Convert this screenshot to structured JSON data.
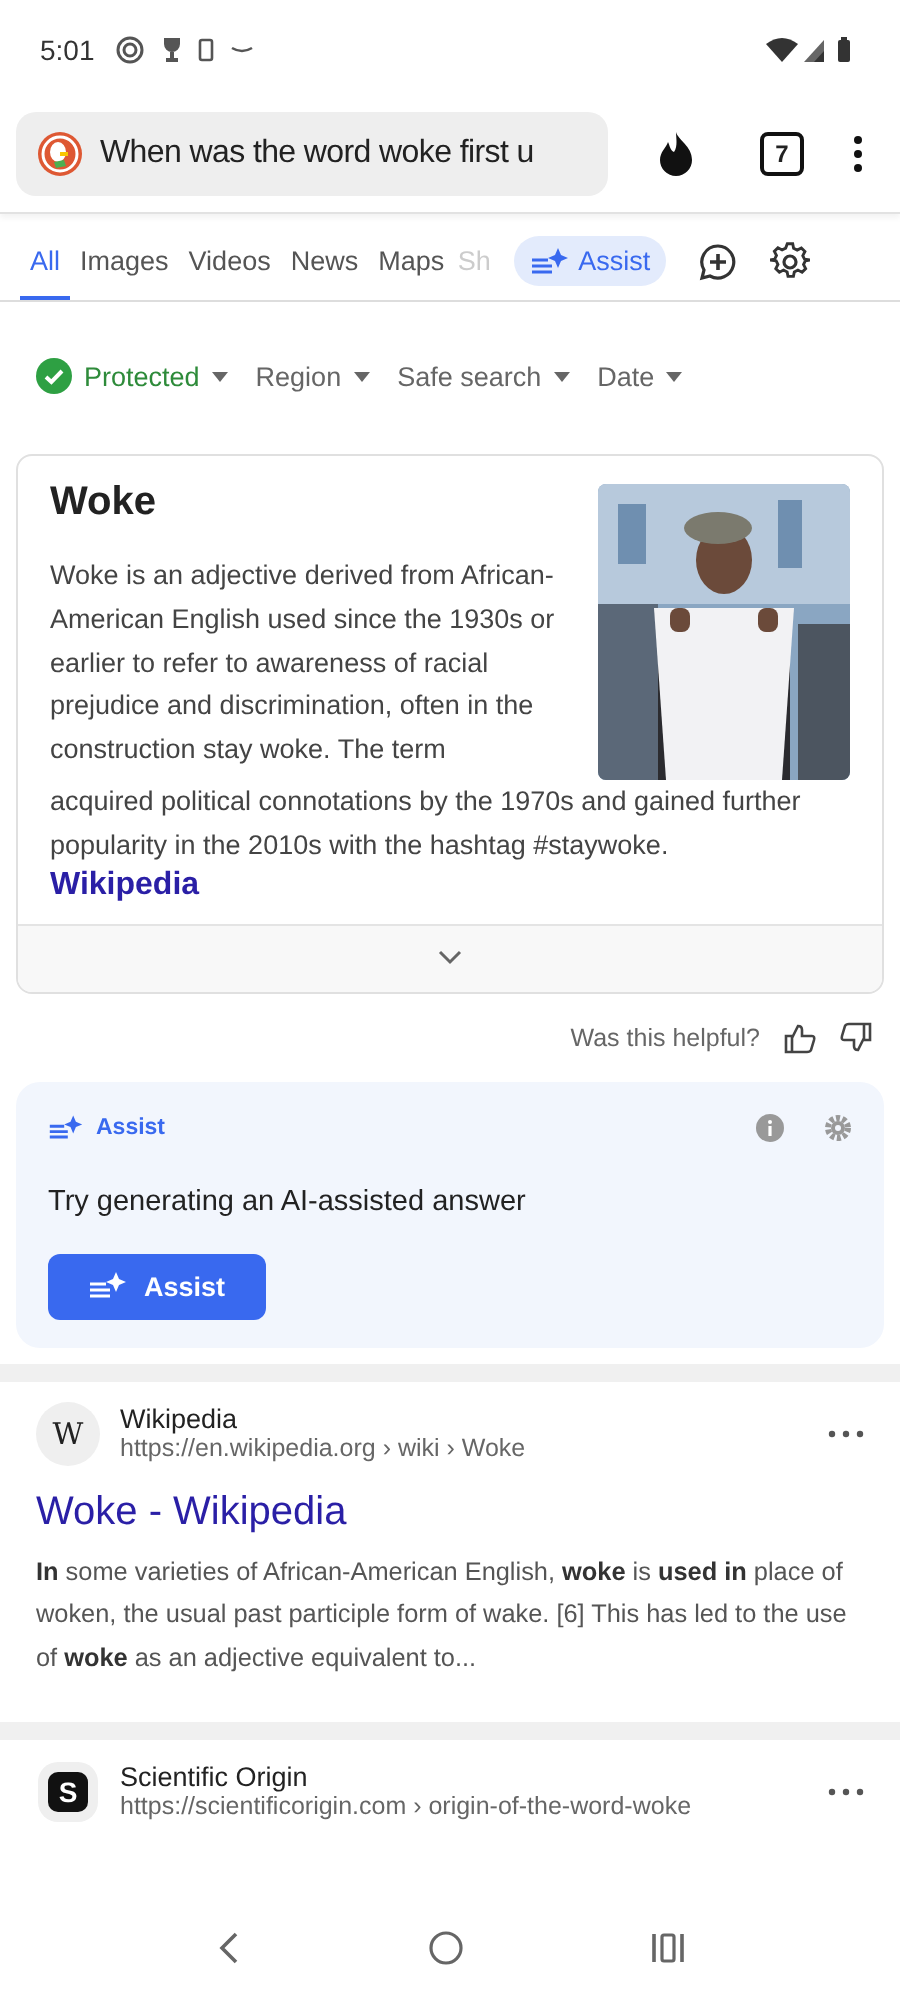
{
  "status_bar": {
    "time": "5:01"
  },
  "search_bar": {
    "query": "When was the word woke first u",
    "tab_count": "7"
  },
  "tabs": [
    {
      "label": "All",
      "selected": true,
      "kind": "plain"
    },
    {
      "label": "Images",
      "selected": false,
      "kind": "plain"
    },
    {
      "label": "Videos",
      "selected": false,
      "kind": "plain"
    },
    {
      "label": "News",
      "selected": false,
      "kind": "plain"
    },
    {
      "label": "Maps",
      "selected": false,
      "kind": "plain"
    },
    {
      "label": "Sh",
      "selected": false,
      "kind": "faded"
    },
    {
      "label": "Assist",
      "selected": false,
      "kind": "assist"
    }
  ],
  "filters": [
    {
      "label": "Protected",
      "kind": "status"
    },
    {
      "label": "Region",
      "kind": "dropdown"
    },
    {
      "label": "Safe search",
      "kind": "dropdown"
    },
    {
      "label": "Date",
      "kind": "dropdown"
    }
  ],
  "info_card": {
    "title": "Woke",
    "kind": "picture",
    "text": [
      "Woke is an adjective derived from African-American English used since the 1930s or earlier to refer to awareness of racial prejudice and discrimination, often in the construction stay woke. The term",
      "acquired political connotations by the 1970s and gained further popularity in the 2010s with the hashtag #staywoke."
    ],
    "source": "Wikipedia"
  },
  "feedback": {
    "question": "Was this helpful?"
  },
  "assist_card": {
    "label": "Assist",
    "prompt": "Try generating an AI-assisted answer",
    "button": "Assist"
  },
  "results": [
    {
      "site": "Wikipedia",
      "url": "https://en.wikipedia.org › wiki › Woke",
      "logo": "W",
      "kind": "wiki",
      "title": "Woke - Wikipedia",
      "snippet": "**In** some varieties of African-American English, **woke** is **used in** place of woken, the usual past participle form of wake. [6] This has led to the use of **woke** as an adjective equivalent to..."
    },
    {
      "site": "Scientific Origin",
      "url": "https://scientificorigin.com › origin-of-the-word-woke",
      "logo": "S",
      "kind": "dark"
    }
  ]
}
